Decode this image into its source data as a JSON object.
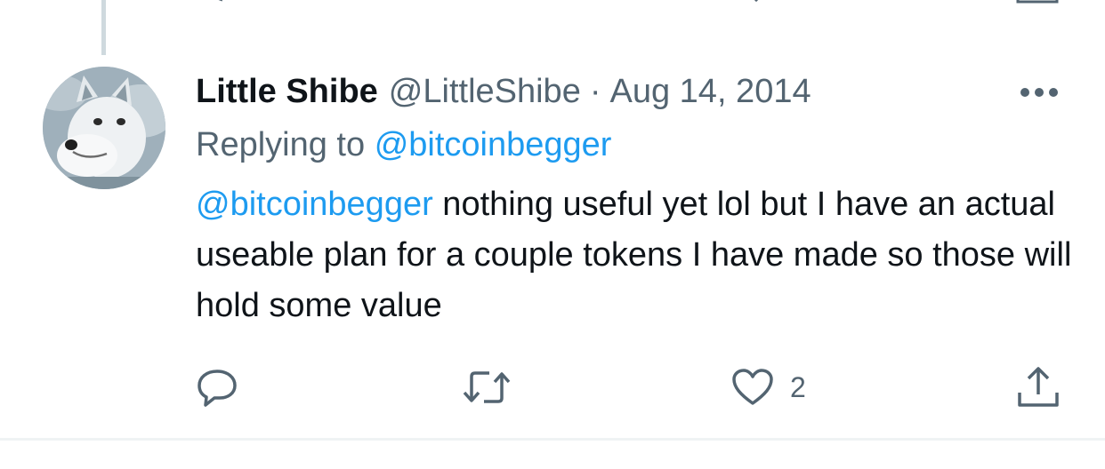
{
  "tweet": {
    "display_name": "Little Shibe",
    "handle": "@LittleShibe",
    "separator": "·",
    "timestamp": "Aug 14, 2014",
    "replying_prefix": "Replying to",
    "replying_to": "@bitcoinbegger",
    "text_mention": "@bitcoinbegger",
    "text_body": " nothing useful yet lol but I have an actual useable plan for a couple tokens I have made so those will hold some value"
  },
  "actions": {
    "like_count": "2",
    "reply_icon": "reply-icon",
    "retweet_icon": "retweet-icon",
    "like_icon": "heart-icon",
    "share_icon": "share-icon",
    "more_icon": "more-icon"
  },
  "colors": {
    "accent": "#1d9bf0",
    "secondary_text": "#536471",
    "primary_text": "#0f1419",
    "thread_line": "#cfd9de",
    "divider": "#eff3f4"
  }
}
